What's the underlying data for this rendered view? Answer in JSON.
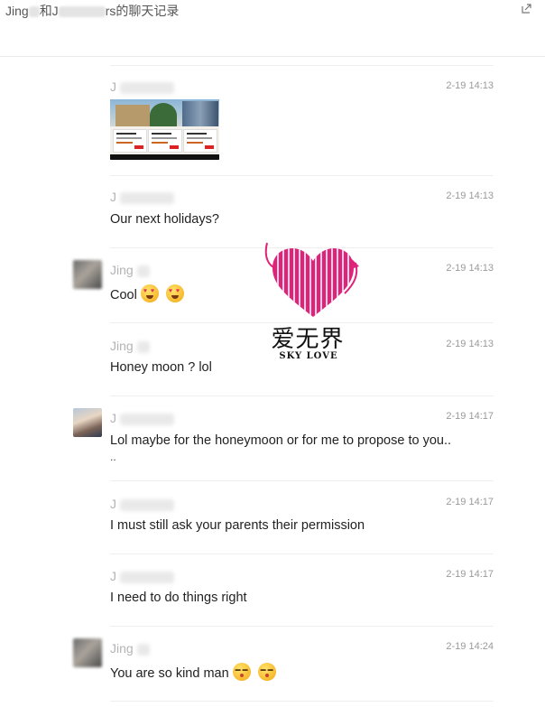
{
  "window": {
    "title_start": "Jing",
    "title_mid": "和J",
    "title_end": "rs的聊天记录"
  },
  "messages": [
    {
      "sender": "J",
      "time": "2-19 14:13",
      "text": "",
      "type": "image"
    },
    {
      "sender": "J",
      "time": "2-19 14:13",
      "text": "Our next holidays?"
    },
    {
      "sender": "Jing",
      "time": "2-19 14:13",
      "text": "Cool",
      "emoji": [
        "heart-eyes-emoji",
        "heart-eyes-emoji"
      ]
    },
    {
      "sender": "Jing",
      "time": "2-19 14:13",
      "text": "Honey moon ? lol"
    },
    {
      "sender": "J",
      "time": "2-19 14:17",
      "text": "Lol maybe for the honeymoon or for me to propose to you..",
      "text2": ".."
    },
    {
      "sender": "J",
      "time": "2-19 14:17",
      "text": "I must still ask your parents their permission"
    },
    {
      "sender": "J",
      "time": "2-19 14:17",
      "text": "I need to do things right"
    },
    {
      "sender": "Jing",
      "time": "2-19 14:24",
      "text": "You are so kind man",
      "emoji": [
        "kissing-emoji",
        "kissing-emoji"
      ]
    }
  ],
  "watermark": {
    "chinese": "爱无界",
    "english": "SKY LOVE",
    "color": "#e0237a"
  },
  "icons": {
    "share": "share-icon"
  }
}
